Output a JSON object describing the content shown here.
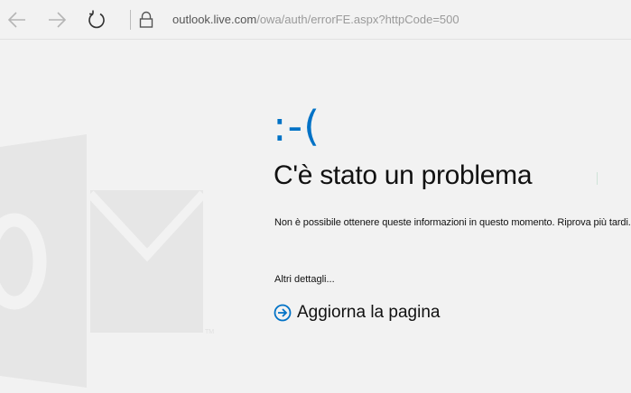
{
  "browser": {
    "url_domain": "outlook.live.com",
    "url_path": "/owa/auth/errorFE.aspx?httpCode=500"
  },
  "error": {
    "face": ":-(",
    "title": "C'è stato un problema",
    "message": "Non è possibile ottenere queste informazioni in questo momento. Riprova più tardi.",
    "details_link": "Altri dettagli...",
    "reload_label": "Aggiorna la pagina"
  },
  "colors": {
    "accent": "#0072c6",
    "background": "#f2f2f2",
    "logo_watermark": "#e6e6e6"
  }
}
